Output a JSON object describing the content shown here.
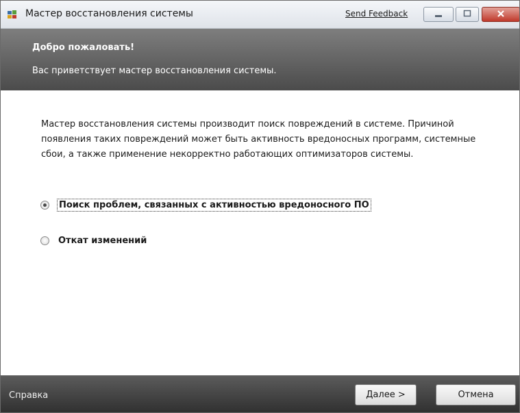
{
  "window": {
    "title": "Мастер восстановления системы",
    "send_feedback": "Send Feedback"
  },
  "header": {
    "title": "Добро пожаловать!",
    "subtitle": "Вас приветствует мастер восстановления системы."
  },
  "content": {
    "description": "Мастер восстановления системы производит поиск повреждений в системе. Причиной появления таких повреждений может быть активность вредоносных программ, системные сбои, а также применение некорректно работающих оптимизаторов системы.",
    "options": [
      {
        "label": "Поиск проблем, связанных с активностью вредоносного ПО",
        "checked": true
      },
      {
        "label": "Откат изменений",
        "checked": false
      }
    ]
  },
  "footer": {
    "help": "Справка",
    "next": "Далее >",
    "cancel": "Отмена"
  }
}
